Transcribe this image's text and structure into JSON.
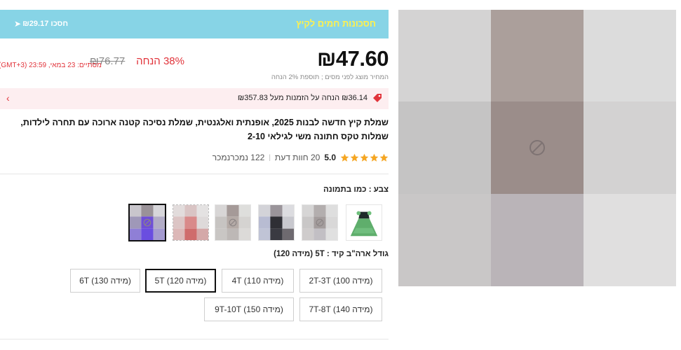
{
  "promo": {
    "title": "חסכונות חמים לקיץ",
    "save_text": "₪29.17 חסכו",
    "icon": "diamond-tag-icon"
  },
  "price": {
    "current": "₪47.60",
    "original": "₪76.77",
    "discount": "38% הנחה",
    "note": "המחיר מוצג לפני מסים ; תוספת 2% הנחה",
    "deadline": "מסתיים: 23 במאי, 23:59 (GMT+3)"
  },
  "coupon": {
    "text": "₪36.14 הנחה על הזמנות מעל ₪357.83",
    "icon": "price-tag-icon",
    "chevron_icon": "chevron-right-icon"
  },
  "product": {
    "title": "שמלת קיץ חדשה לבנות 2025, אופנתית ואלגנטית, שמלת נסיכה קטנה ארוכה עם תחרה לילדות, שמלות טקס חתונה משי לגילאי 2-10"
  },
  "rating": {
    "value": "5.0",
    "stars": 5,
    "reviews": "20 חוות דעת",
    "sold": "122 נמכרנמכר",
    "star_color": "#f5a623"
  },
  "colors": {
    "label": "צבע : כמו בתמונה",
    "swatches": [
      {
        "name": "green-dress",
        "icon": "dress-thumbnail"
      },
      {
        "name": "gray",
        "icon": "broken-image-icon"
      },
      {
        "name": "dark",
        "icon": "image-thumbnail"
      },
      {
        "name": "beige",
        "icon": "broken-image-icon"
      },
      {
        "name": "red",
        "icon": "image-thumbnail"
      },
      {
        "name": "purple",
        "icon": "broken-image-icon",
        "selected": true
      }
    ]
  },
  "sizes": {
    "label": "גודל ארה\"ב קיד : 5T (מידה 120)",
    "options": [
      "2T-3T (מידה 100)",
      "4T (מידה 110)",
      "5T (מידה 120)",
      "6T (מידה 130)",
      "7T-8T (מידה 140)",
      "9T-10T (מידה 150)"
    ],
    "selected_index": 2
  },
  "main_image": {
    "icon": "broken-image-icon"
  },
  "colors_palette": {
    "accent": "#e1343b",
    "promo_bg": "#87d4e6",
    "promo_title": "#fff14d",
    "coupon_bg": "#fdeef0"
  }
}
